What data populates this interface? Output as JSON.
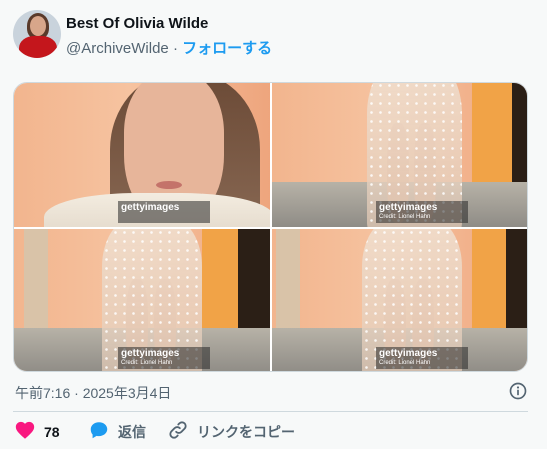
{
  "author": {
    "name": "Best Of Olivia Wilde",
    "handle": "@ArchiveWilde",
    "separator": "·",
    "follow_label": "フォローする"
  },
  "media": {
    "watermark_brand": "gettyimages",
    "watermark_credit": "Credit: Lionel Hahn"
  },
  "timestamp": "午前7:16 · 2025年3月4日",
  "actions": {
    "like_count": "78",
    "reply_label": "返信",
    "copy_link_label": "リンクをコピー"
  },
  "colors": {
    "like": "#f91880",
    "reply": "#1d9bf0",
    "follow": "#1d9bf0",
    "secondary_text": "#536471"
  },
  "icons": [
    "heart-icon",
    "speech-bubble-icon",
    "link-icon",
    "info-icon"
  ]
}
